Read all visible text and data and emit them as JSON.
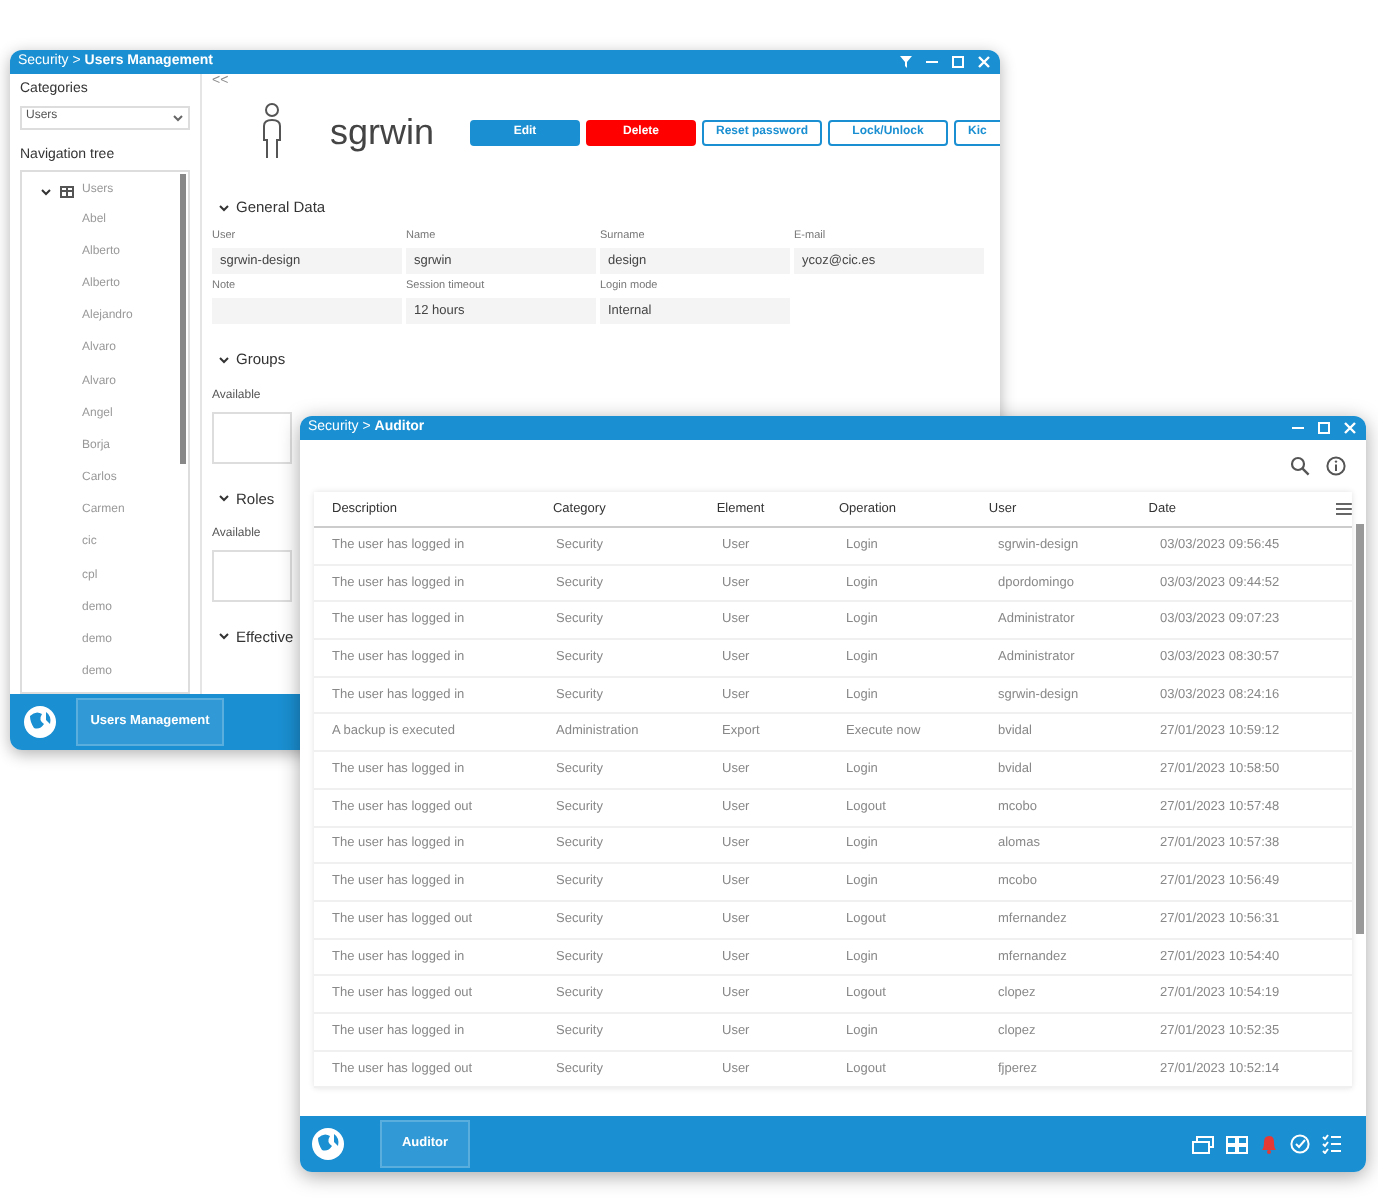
{
  "users_window": {
    "title": "Security > **Users Management**",
    "categories_label": "Categories",
    "category": "Users",
    "navigation_label": "Navigation tree",
    "tree": [
      {
        "label": "Users",
        "expanded": true,
        "children": [
          {
            "label": "Abel"
          },
          {
            "label": "Alberto"
          },
          {
            "label": "Alberto"
          },
          {
            "label": "Alejandro"
          },
          {
            "label": "Alvaro"
          },
          {
            "label": "Alvaro"
          },
          {
            "label": "Angel"
          },
          {
            "label": "Borja"
          },
          {
            "label": "Carlos"
          },
          {
            "label": "Carmen"
          },
          {
            "label": "cic"
          },
          {
            "label": "cpl"
          },
          {
            "label": "demo"
          },
          {
            "label": "demo"
          },
          {
            "label": "demo"
          }
        ]
      }
    ],
    "collapse_button": "<<",
    "user_name": "sgrwin",
    "actions": [
      {
        "label": "Edit",
        "kind": "primary"
      },
      {
        "label": "Delete",
        "kind": "danger"
      },
      {
        "label": "Reset password",
        "kind": "outline"
      },
      {
        "label": "Lock/Unlock",
        "kind": "outline"
      },
      {
        "label": "Kic",
        "kind": "outline"
      }
    ],
    "sections": [
      {
        "title": "General Data",
        "expanded": true,
        "kind": "fields",
        "fields": [
          {
            "label": "User",
            "value": "sgrwin-design"
          },
          {
            "label": "Name",
            "value": "sgrwin"
          },
          {
            "label": "Surname",
            "value": "design"
          },
          {
            "label": "E-mail",
            "value": "ycoz@cic.es"
          },
          {
            "label": "Note"
          },
          {
            "label": "Session timeout",
            "value": "12 hours"
          },
          {
            "label": "Login mode",
            "value": "Internal"
          }
        ]
      },
      {
        "title": "Groups",
        "expanded": true,
        "kind": "list",
        "list_label": "Available"
      },
      {
        "title": "Roles",
        "expanded": true,
        "kind": "list",
        "list_label": "Available"
      },
      {
        "title": "Effective",
        "expanded": true,
        "kind": "cut"
      }
    ],
    "taskbar_tab": "Users Management"
  },
  "auditor_window": {
    "title": "Security > **Auditor**",
    "columns": [
      "Description",
      "Category",
      "Element",
      "Operation",
      "User",
      "Date"
    ],
    "rows": [
      [
        "The user has logged in",
        "Security",
        "User",
        "Login",
        "sgrwin-design",
        "03/03/2023 09:56:45"
      ],
      [
        "The user has logged in",
        "Security",
        "User",
        "Login",
        "dpordomingo",
        "03/03/2023 09:44:52"
      ],
      [
        "The user has logged in",
        "Security",
        "User",
        "Login",
        "Administrator",
        "03/03/2023 09:07:23"
      ],
      [
        "The user has logged in",
        "Security",
        "User",
        "Login",
        "Administrator",
        "03/03/2023 08:30:57"
      ],
      [
        "The user has logged in",
        "Security",
        "User",
        "Login",
        "sgrwin-design",
        "03/03/2023 08:24:16"
      ],
      [
        "A backup is executed",
        "Administration",
        "Export",
        "Execute now",
        "bvidal",
        "27/01/2023 10:59:12"
      ],
      [
        "The user has logged in",
        "Security",
        "User",
        "Login",
        "bvidal",
        "27/01/2023 10:58:50"
      ],
      [
        "The user has logged out",
        "Security",
        "User",
        "Logout",
        "mcobo",
        "27/01/2023 10:57:48"
      ],
      [
        "The user has logged in",
        "Security",
        "User",
        "Login",
        "alomas",
        "27/01/2023 10:57:38"
      ],
      [
        "The user has logged in",
        "Security",
        "User",
        "Login",
        "mcobo",
        "27/01/2023 10:56:49"
      ],
      [
        "The user has logged out",
        "Security",
        "User",
        "Logout",
        "mfernandez",
        "27/01/2023 10:56:31"
      ],
      [
        "The user has logged in",
        "Security",
        "User",
        "Login",
        "mfernandez",
        "27/01/2023 10:54:40"
      ],
      [
        "The user has logged out",
        "Security",
        "User",
        "Logout",
        "clopez",
        "27/01/2023 10:54:19"
      ],
      [
        "The user has logged in",
        "Security",
        "User",
        "Login",
        "clopez",
        "27/01/2023 10:52:35"
      ],
      [
        "The user has logged out",
        "Security",
        "User",
        "Logout",
        "fjperez",
        "27/01/2023 10:52:14"
      ]
    ],
    "taskbar_tab": "Auditor"
  }
}
